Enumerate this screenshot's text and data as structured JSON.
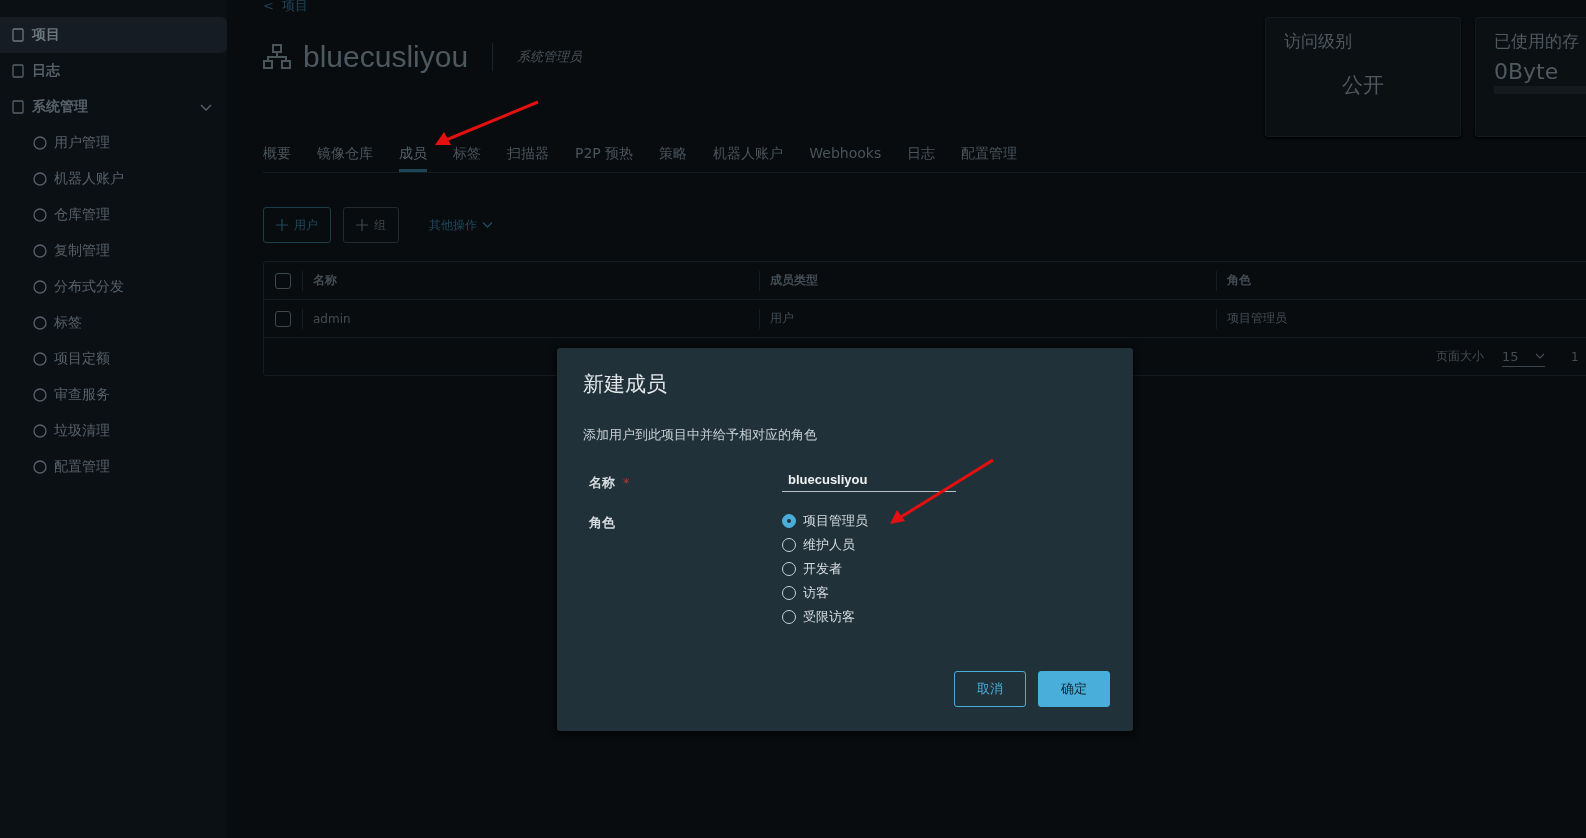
{
  "sidebar": {
    "items": [
      {
        "label": "项目",
        "selected": true
      },
      {
        "label": "日志",
        "selected": false
      },
      {
        "label": "系统管理",
        "selected": false,
        "expanded": true,
        "children": [
          {
            "label": "用户管理",
            "selected": false
          },
          {
            "label": "机器人账户",
            "selected": false
          },
          {
            "label": "仓库管理",
            "selected": false
          },
          {
            "label": "复制管理",
            "selected": false
          },
          {
            "label": "分布式分发",
            "selected": false
          },
          {
            "label": "标签",
            "selected": false
          },
          {
            "label": "项目定额",
            "selected": false
          },
          {
            "label": "审查服务",
            "selected": false
          },
          {
            "label": "垃圾清理",
            "selected": false
          },
          {
            "label": "配置管理",
            "selected": false
          }
        ]
      }
    ]
  },
  "breadcrumb": {
    "back": "<",
    "label": "项目"
  },
  "project": {
    "name": "bluecusliyou",
    "role": "系统管理员"
  },
  "cards": [
    {
      "title": "访问级别",
      "value": "公开",
      "kind": "plain"
    },
    {
      "title": "已使用的存",
      "value": "0Byte",
      "kind": "meter"
    }
  ],
  "tabs": [
    {
      "label": "概要",
      "selected": false
    },
    {
      "label": "镜像仓库",
      "selected": false
    },
    {
      "label": "成员",
      "selected": true
    },
    {
      "label": "标签",
      "selected": false
    },
    {
      "label": "扫描器",
      "selected": false
    },
    {
      "label": "P2P 预热",
      "selected": false
    },
    {
      "label": "策略",
      "selected": false
    },
    {
      "label": "机器人账户",
      "selected": false
    },
    {
      "label": "Webhooks",
      "selected": false
    },
    {
      "label": "日志",
      "selected": false
    },
    {
      "label": "配置管理",
      "selected": false
    }
  ],
  "toolbar": {
    "add_user": "用户",
    "add_group": "组",
    "more": "其他操作"
  },
  "table": {
    "columns": [
      "名称",
      "成员类型",
      "角色"
    ],
    "header_checked": false,
    "rows": [
      {
        "checked": false,
        "cells": [
          "admin",
          "用户",
          "项目管理员"
        ]
      }
    ],
    "footer": {
      "page_size_label": "页面大小",
      "page_size": "15",
      "range": "1"
    }
  },
  "dialog": {
    "title": "新建成员",
    "description": "添加用户到此项目中并给予相对应的角色",
    "name_label": "名称",
    "required_mark": "*",
    "name_value": "bluecusliyou",
    "role_label": "角色",
    "roles": [
      {
        "label": "项目管理员",
        "selected": true
      },
      {
        "label": "维护人员",
        "selected": false
      },
      {
        "label": "开发者",
        "selected": false
      },
      {
        "label": "访客",
        "selected": false
      },
      {
        "label": "受限访客",
        "selected": false
      }
    ],
    "buttons": [
      {
        "label": "取消",
        "kind": "secondary"
      },
      {
        "label": "确定",
        "kind": "primary"
      }
    ]
  }
}
